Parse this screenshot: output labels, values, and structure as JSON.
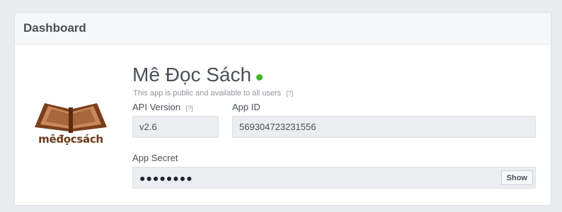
{
  "header": {
    "title": "Dashboard"
  },
  "app": {
    "logo_text": "mêđọcsách",
    "name": "Mê Đọc Sách",
    "status_color": "#42b72a",
    "description": "This app is public and available to all users",
    "help_marker": "[?]"
  },
  "fields": {
    "api_version": {
      "label": "API Version",
      "help": "[?]",
      "value": "v2.6"
    },
    "app_id": {
      "label": "App ID",
      "value": "569304723231556"
    },
    "app_secret": {
      "label": "App Secret",
      "value": "●●●●●●●●",
      "show_label": "Show"
    }
  }
}
